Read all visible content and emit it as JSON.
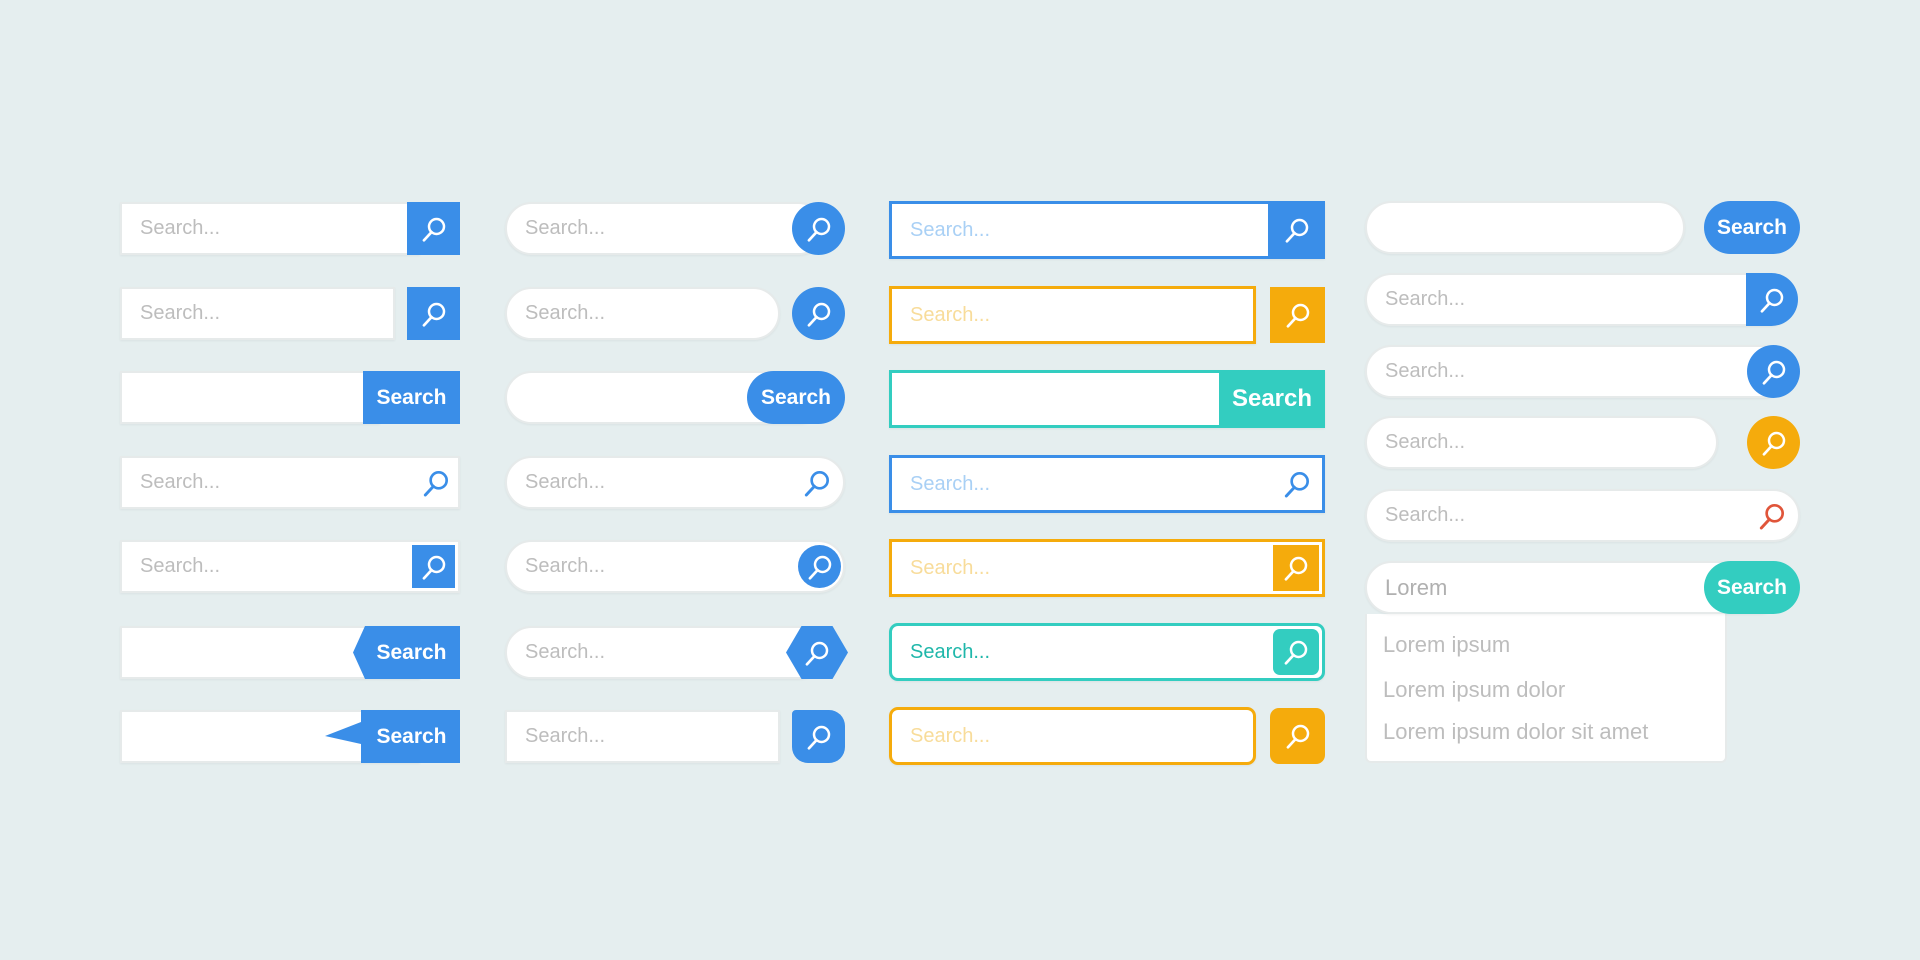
{
  "placeholder": "Search...",
  "button_label": "Search",
  "colors": {
    "blue": "#3a8ee8",
    "yellow": "#f5ab0c",
    "teal": "#33cdc0",
    "red": "#e0553a",
    "background": "#e5eeef"
  },
  "icon": "magnifier-icon",
  "autocomplete": {
    "query": "Lorem",
    "suggestions": [
      "Lorem ipsum",
      "Lorem ipsum dolor",
      "Lorem ipsum dolor sit amet"
    ]
  }
}
